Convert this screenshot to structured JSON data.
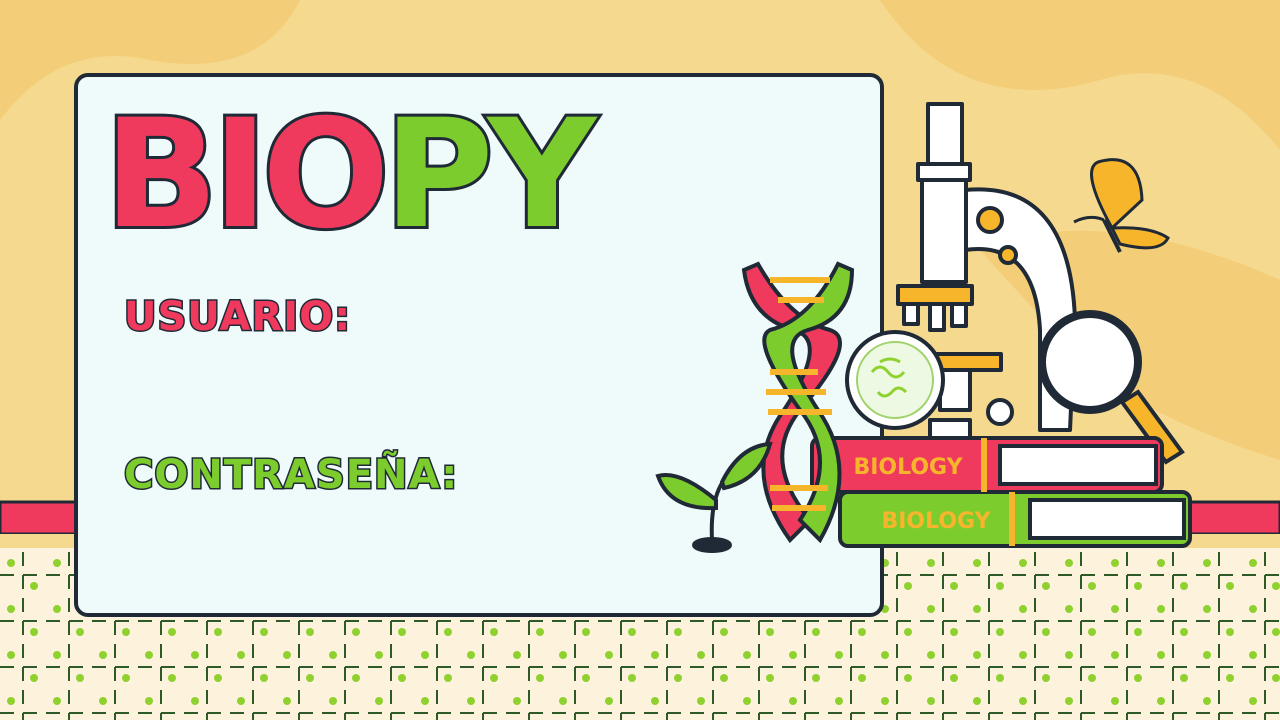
{
  "app": {
    "title_part1": "BIO",
    "title_part2": "PY"
  },
  "form": {
    "username_label": "USUARIO:",
    "username_value": "",
    "password_label": "CONTRASEÑA:",
    "password_value": ""
  },
  "books": {
    "top_label": "BIOLOGY",
    "bottom_label": "BIOLOGY"
  },
  "colors": {
    "background": "#f5d98f",
    "red": "#ef3a5d",
    "green": "#7dcc2e",
    "outline": "#1f2a36",
    "panel": "#effbfb"
  },
  "icons": [
    "dna-icon",
    "sprout-icon",
    "microscope-icon",
    "magnifier-icon",
    "petri-dish-icon",
    "butterfly-icon",
    "books-icon"
  ]
}
